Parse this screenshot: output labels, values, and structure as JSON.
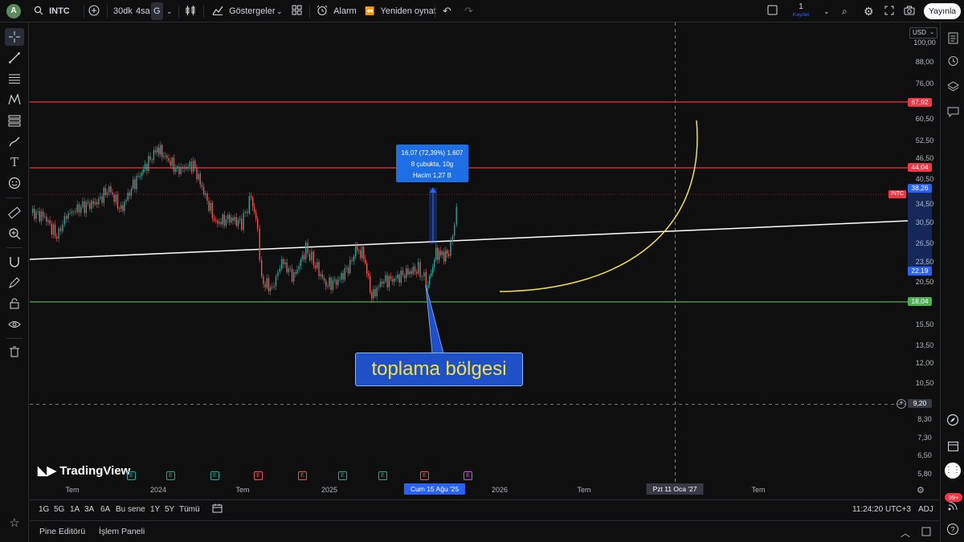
{
  "toolbar": {
    "avatar_letter": "A",
    "symbol": "INTC",
    "intervals": [
      "30dk",
      "4sa",
      "G"
    ],
    "indicators": "Göstergeler",
    "alarm": "Alarm",
    "replay": "Yeniden oynat",
    "layout_count": "1",
    "layout_save": "Kaydet",
    "publish": "Yayınla"
  },
  "chart": {
    "currency": "USD",
    "watermark": "TradingView",
    "symbol_tag": "INTC",
    "price_ticks": [
      "100,00",
      "88,00",
      "76,00",
      "60,50",
      "52,50",
      "46,50",
      "40,50",
      "34,50",
      "30,50",
      "26,50",
      "23,50",
      "20,50",
      "15,50",
      "13,50",
      "12,00",
      "10,50",
      "8,30",
      "7,30",
      "6,50",
      "5,80"
    ],
    "price_tags": {
      "resistance_high": "67,92",
      "resistance_mid": "44,04",
      "current": "38,26",
      "range_low": "22,19",
      "support": "18,04",
      "crosshair": "9,20"
    },
    "time_ticks": [
      "Tem",
      "2024",
      "Tem",
      "2025",
      "2026",
      "Tem",
      "Tem"
    ],
    "time_highlight_1": "Cum 15 Ağu '25",
    "time_highlight_2": "Pzt 11 Oca '27",
    "measure": {
      "line1": "16,07 (72,39%) 1.607",
      "line2": "8 çubukta, 10g",
      "line3": "Hacim 1,27 B"
    },
    "callout_text": "toplama bölgesi",
    "earnings_marker": "E",
    "colors": {
      "up": "#26a69a",
      "down": "#ef5350",
      "resistance": "#f23645",
      "support": "#4caf50",
      "arc": "#f5e04a",
      "accent": "#2962ff",
      "callout": "#1e50c8"
    }
  },
  "range": {
    "buttons": [
      "1G",
      "5G",
      "1A",
      "3A",
      "6A",
      "Bu sene",
      "1Y",
      "5Y",
      "Tümü"
    ],
    "clock": "11:24:20 UTC+3",
    "adj": "ADJ"
  },
  "bottom": {
    "tabs": [
      "Pine Editörü",
      "İşlem Paneli"
    ]
  },
  "right": {
    "notifications": "99+"
  }
}
